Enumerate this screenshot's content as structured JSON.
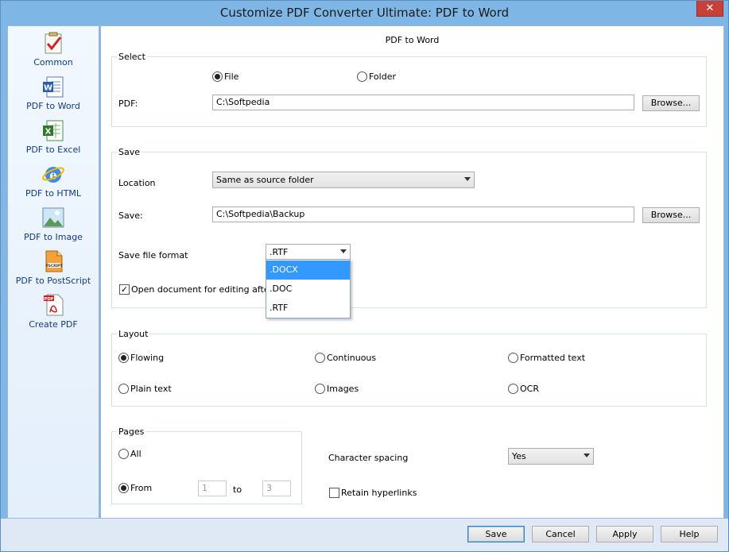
{
  "window": {
    "title": "Customize PDF Converter Ultimate: PDF to Word",
    "close_glyph": "✕"
  },
  "sidebar": {
    "items": [
      {
        "label": "Common",
        "icon": "checklist-icon"
      },
      {
        "label": "PDF to Word",
        "icon": "word-document-icon"
      },
      {
        "label": "PDF to Excel",
        "icon": "excel-document-icon"
      },
      {
        "label": "PDF to HTML",
        "icon": "internet-explorer-icon"
      },
      {
        "label": "PDF to Image",
        "icon": "image-icon"
      },
      {
        "label": "PDF to PostScript",
        "icon": "postscript-icon"
      },
      {
        "label": "Create PDF",
        "icon": "pdf-document-icon"
      }
    ]
  },
  "page": {
    "title": "PDF to Word"
  },
  "select": {
    "legend": "Select",
    "file_label": "File",
    "folder_label": "Folder",
    "pdf_label": "PDF:",
    "pdf_value": "C:\\Softpedia",
    "browse_label": "Browse..."
  },
  "save": {
    "legend": "Save",
    "location_label": "Location",
    "location_value": "Same as source folder",
    "save_label": "Save:",
    "save_value": "C:\\Softpedia\\Backup",
    "browse_label": "Browse...",
    "format_label": "Save file format",
    "format_value": ".RTF",
    "format_options": [
      ".DOCX",
      ".DOC",
      ".RTF"
    ],
    "open_doc_label": "Open document for editing after co"
  },
  "layout": {
    "legend": "Layout",
    "options": {
      "flowing": "Flowing",
      "continuous": "Continuous",
      "formatted": "Formatted text",
      "plain": "Plain text",
      "images": "Images",
      "ocr": "OCR"
    }
  },
  "pages": {
    "legend": "Pages",
    "all_label": "All",
    "from_label": "From",
    "from_value": "1",
    "to_label": "to",
    "to_value": "3"
  },
  "options": {
    "char_spacing_label": "Character spacing",
    "char_spacing_value": "Yes",
    "retain_links_label": "Retain hyperlinks"
  },
  "footer": {
    "save": "Save",
    "cancel": "Cancel",
    "apply": "Apply",
    "help": "Help"
  },
  "colors": {
    "accent": "#3399ff",
    "sidebar_text": "#123a80",
    "frame": "#7eb7e6"
  }
}
